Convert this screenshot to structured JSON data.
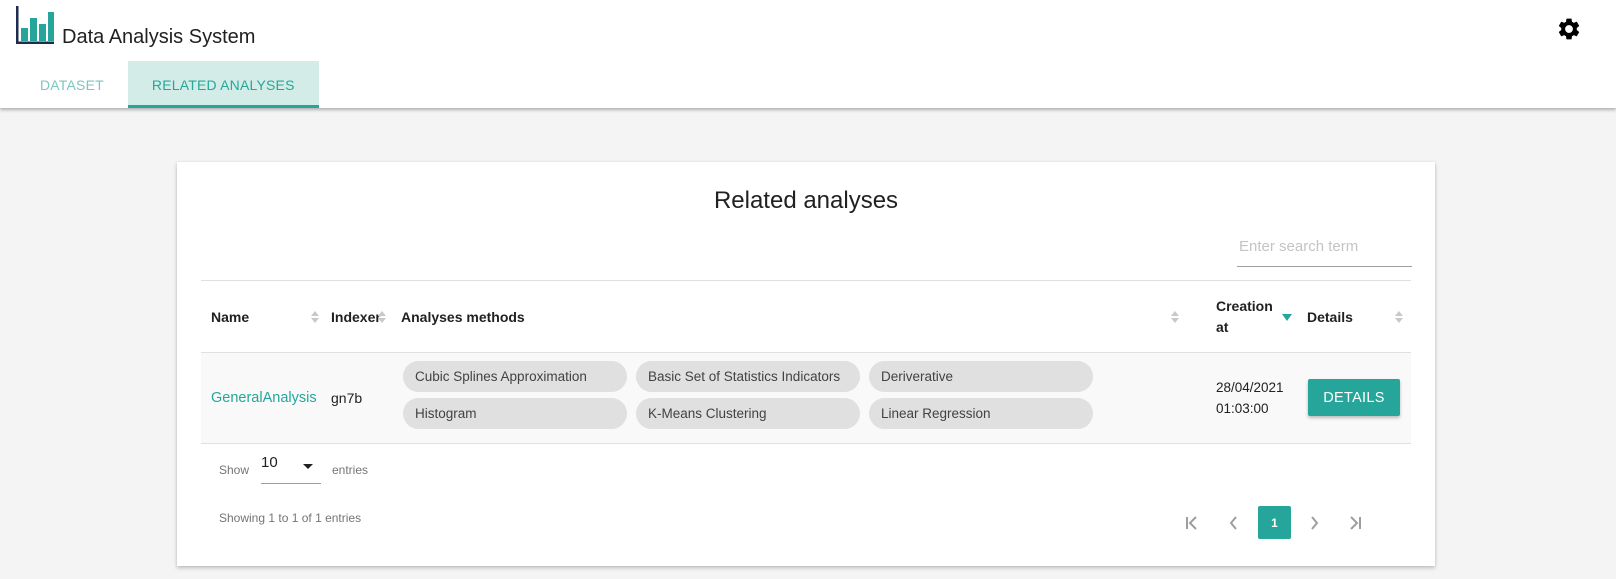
{
  "app": {
    "title": "Data Analysis System",
    "logo_icon": "bar-chart-icon",
    "settings_icon": "gear-icon",
    "accent_color": "#26a69a"
  },
  "tabs": [
    {
      "label": "DATASET",
      "active": false
    },
    {
      "label": "RELATED ANALYSES",
      "active": true
    }
  ],
  "card": {
    "title": "Related analyses",
    "search": {
      "placeholder": "Enter search term",
      "value": ""
    }
  },
  "table": {
    "columns": [
      {
        "label": "Name",
        "sort": "none"
      },
      {
        "label": "Indexer",
        "sort": "none"
      },
      {
        "label": "Analyses methods",
        "sort": "none"
      },
      {
        "label": "Creation at",
        "label_line1": "Creation",
        "label_line2": "at",
        "sort": "descending"
      },
      {
        "label": "Details",
        "sort": "none"
      }
    ],
    "rows": [
      {
        "name": "GeneralAnalysis",
        "indexer": "gn7b",
        "methods": [
          "Cubic Splines Approximation",
          "Basic Set of Statistics Indicators",
          "Deriverative",
          "Histogram",
          "K-Means Clustering",
          "Linear Regression"
        ],
        "created_date": "28/04/2021",
        "created_time": "01:03:00",
        "details_label": "DETAILS"
      }
    ]
  },
  "footer": {
    "show_label": "Show",
    "page_size": "10",
    "entries_label": "entries",
    "info": "Showing 1 to 1 of 1 entries",
    "current_page": "1",
    "pager_icons": [
      "first-page-icon",
      "prev-page-icon",
      "next-page-icon",
      "last-page-icon"
    ]
  }
}
